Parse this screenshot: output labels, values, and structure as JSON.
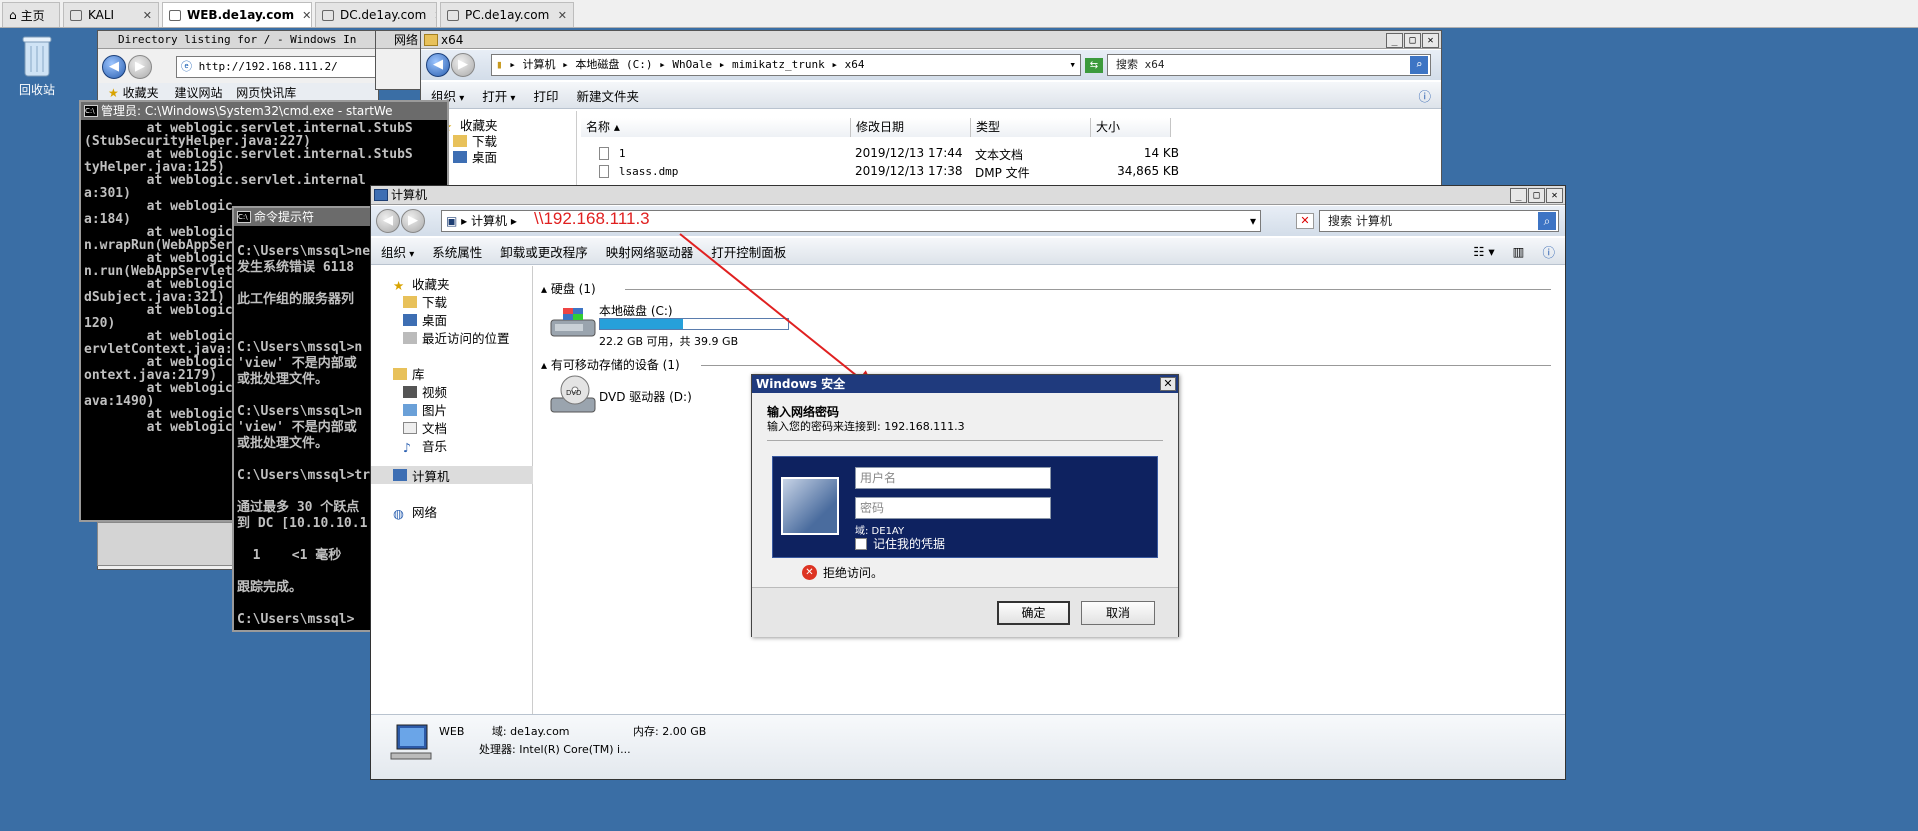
{
  "browser_tabs": [
    {
      "label": "主页"
    },
    {
      "label": "KALI"
    },
    {
      "label": "WEB.de1ay.com"
    },
    {
      "label": "DC.de1ay.com"
    },
    {
      "label": "PC.de1ay.com"
    }
  ],
  "desktop": {
    "recycle_bin_label": "回收站"
  },
  "ie_window": {
    "title": "Directory listing for / - Windows In",
    "address": "http://192.168.111.2/",
    "fav_label": "收藏夹",
    "fav_item_1": "建议网站",
    "fav_item_2": "网页快讯库"
  },
  "net_stub_title": "网络",
  "cmd_admin": {
    "title": "管理员: C:\\Windows\\System32\\cmd.exe - startWe",
    "lines": [
      "        at weblogic.servlet.internal.StubS",
      "(StubSecurityHelper.java:227)",
      "        at weblogic.servlet.internal.StubS",
      "tyHelper.java:125)",
      "        at weblogic.servlet.internal",
      "a:301)",
      "        at weblogic",
      "a:184)",
      "        at weblogic",
      "n.wrapRun(WebAppSer",
      "        at weblogic",
      "n.run(WebAppServlet",
      "        at weblogic",
      "dSubject.java:321)",
      "        at weblogic",
      "120)",
      "        at weblogic",
      "ervletContext.java:",
      "        at weblogic",
      "ontext.java:2179)",
      "        at weblogic",
      "ava:1490)",
      "        at weblogic",
      "        at weblogic"
    ]
  },
  "cmd_prompt": {
    "title": "命令提示符",
    "lines": [
      "",
      "C:\\Users\\mssql>ne",
      "发生系统错误 6118",
      "",
      "此工作组的服务器列",
      "",
      "",
      "C:\\Users\\mssql>n",
      "'view' 不是内部或",
      "或批处理文件。",
      "",
      "C:\\Users\\mssql>n",
      "'view' 不是内部或",
      "或批处理文件。",
      "",
      "C:\\Users\\mssql>tr",
      "",
      "通过最多 30 个跃点",
      "到 DC [10.10.10.1",
      "",
      "  1    <1 毫秒",
      "",
      "跟踪完成。",
      "",
      "C:\\Users\\mssql>"
    ]
  },
  "explorer_x64": {
    "title": "x64",
    "breadcrumb": [
      "计算机",
      "本地磁盘 (C:)",
      "WhOale",
      "mimikatz_trunk",
      "x64"
    ],
    "search_placeholder": "搜索 x64",
    "toolbar": [
      "组织",
      "打开",
      "打印",
      "新建文件夹"
    ],
    "nav": [
      "收藏夹",
      "下载",
      "桌面"
    ],
    "columns": [
      "名称",
      "修改日期",
      "类型",
      "大小"
    ],
    "files": [
      {
        "name": "1",
        "date": "2019/12/13 17:44",
        "type": "文本文档",
        "size": "14 KB"
      },
      {
        "name": "lsass.dmp",
        "date": "2019/12/13 17:38",
        "type": "DMP 文件",
        "size": "34,865 KB"
      }
    ]
  },
  "explorer_computer": {
    "title": "计算机",
    "crumb": "计算机",
    "address_overlay": "\\\\192.168.111.3",
    "search_placeholder": "搜索 计算机",
    "toolbar": [
      "组织",
      "系统属性",
      "卸载或更改程序",
      "映射网络驱动器",
      "打开控制面板"
    ],
    "nav": {
      "favorites": "收藏夹",
      "downloads": "下载",
      "desktop": "桌面",
      "recent": "最近访问的位置",
      "libraries": "库",
      "videos": "视频",
      "pictures": "图片",
      "documents": "文档",
      "music": "音乐",
      "computer": "计算机",
      "network": "网络"
    },
    "group_hdd": "硬盘 (1)",
    "drive_c_name": "本地磁盘 (C:)",
    "drive_c_free": "22.2 GB 可用，共 39.9 GB",
    "drive_c_used_fraction": 0.44,
    "group_removable": "有可移动存储的设备 (1)",
    "dvd_name": "DVD 驱动器 (D:)",
    "status": {
      "name": "WEB",
      "domain_label": "域:",
      "domain": "de1ay.com",
      "memory_label": "内存:",
      "memory": "2.00 GB",
      "cpu_label": "处理器:",
      "cpu": "Intel(R) Core(TM) i..."
    }
  },
  "security_dialog": {
    "title": "Windows 安全",
    "heading": "输入网络密码",
    "subtitle": "输入您的密码来连接到: 192.168.111.3",
    "username_placeholder": "用户名",
    "password_placeholder": "密码",
    "domain_line": "域: DE1AY",
    "remember_label": "记住我的凭据",
    "error": "拒绝访问。",
    "ok_label": "确定",
    "cancel_label": "取消"
  },
  "colors": {
    "annotation": "#e02020",
    "desktop": "#3a6ea5",
    "dialog_title": "#1f3a7d",
    "credential_panel": "#0e2260"
  }
}
